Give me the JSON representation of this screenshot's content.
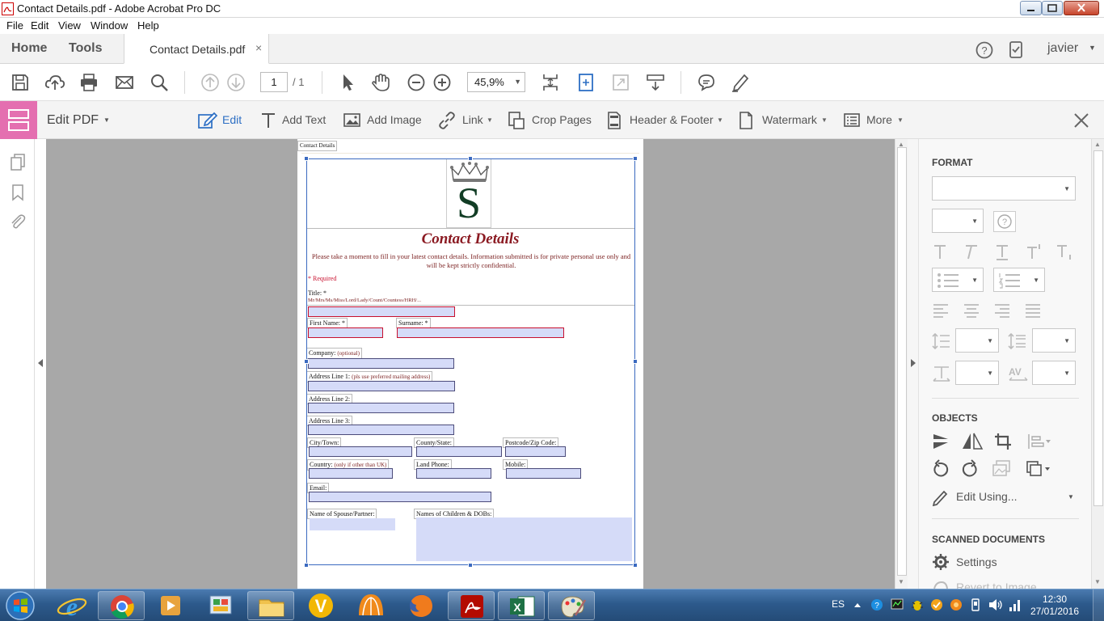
{
  "window": {
    "title": "Contact Details.pdf - Adobe Acrobat Pro DC"
  },
  "menu": [
    "File",
    "Edit",
    "View",
    "Window",
    "Help"
  ],
  "tabs": {
    "home": "Home",
    "tools": "Tools",
    "document": "Contact Details.pdf",
    "close": "×"
  },
  "user": {
    "name": "javier"
  },
  "toolbar": {
    "page_current": "1",
    "page_total": "/ 1",
    "zoom": "45,9%"
  },
  "edit_toolbar": {
    "title": "Edit PDF",
    "tools": [
      {
        "label": "Edit",
        "icon": "edit-icon"
      },
      {
        "label": "Add Text",
        "icon": "text-icon"
      },
      {
        "label": "Add Image",
        "icon": "image-icon"
      },
      {
        "label": "Link",
        "icon": "link-icon"
      },
      {
        "label": "Crop Pages",
        "icon": "crop-icon"
      },
      {
        "label": "Header & Footer",
        "icon": "header-footer-icon"
      },
      {
        "label": "Watermark",
        "icon": "watermark-icon"
      },
      {
        "label": "More",
        "icon": "more-icon"
      }
    ]
  },
  "right_panel": {
    "format_heading": "FORMAT",
    "objects_heading": "OBJECTS",
    "edit_using": "Edit Using...",
    "scanned_heading": "SCANNED DOCUMENTS",
    "settings": "Settings",
    "revert": "Revert to Image"
  },
  "form": {
    "tag": "Contact Details",
    "logo_letter": "S",
    "heading": "Contact Details",
    "intro": "Please take a moment to fill in your latest contact details. Information submitted is for private personal use only and will be kept strictly confidential.",
    "required_note": "* Required",
    "title_label": "Title: *",
    "title_hint": "Mr/Mrs/Ms/Miss/Lord/Lady/Count/Countess/HRH/...",
    "first_name": "First Name: *",
    "surname": "Surname: *",
    "company": "Company:",
    "company_hint": "(optional)",
    "address1": "Address Line 1:",
    "address1_hint": "(pls use preferred mailing address)",
    "address2": "Address Line 2:",
    "address3": "Address Line 3:",
    "city": "City/Town:",
    "county": "County/State:",
    "postcode": "Postcode/Zip Code:",
    "country": "Country:",
    "country_hint": "(only if other than UK)",
    "land_phone": "Land Phone:",
    "mobile": "Mobile:",
    "email": "Email:",
    "spouse": "Name of Spouse/Partner:",
    "children": "Names of Children & DOBs:"
  },
  "tray": {
    "lang": "ES",
    "time": "12:30",
    "date": "27/01/2016"
  },
  "colors": {
    "accent": "#2d6fc4",
    "edit_pink": "#e46fb0",
    "form_red": "#7a1f1f",
    "field_fill": "#d5dbf8"
  }
}
